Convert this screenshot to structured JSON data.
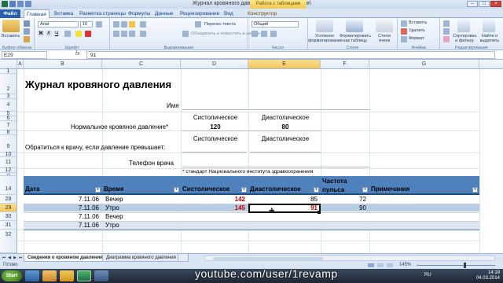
{
  "window": {
    "title": "Журнал кровяного давления1 - Microsoft Excel",
    "context_tab": "Работа с таблицами",
    "min_label": "–",
    "max_label": "□",
    "close_label": "×"
  },
  "ribbon_tabs": [
    {
      "label": "Файл"
    },
    {
      "label": "Главная"
    },
    {
      "label": "Вставка"
    },
    {
      "label": "Разметка страницы"
    },
    {
      "label": "Формулы"
    },
    {
      "label": "Данные"
    },
    {
      "label": "Рецензирование"
    },
    {
      "label": "Вид"
    },
    {
      "label": "Конструктор"
    }
  ],
  "ribbon": {
    "paste_label": "Вставить",
    "font_name": "Arial",
    "font_size": "10",
    "wrap_text": "Перенос текста",
    "merge_center": "Объединить и поместить в центре",
    "number_format": "Общий",
    "cond_format": "Условное форматирование",
    "format_table": "Форматировать как таблицу",
    "cell_styles": "Стили ячеек",
    "insert": "Вставить",
    "delete": "Удалить",
    "format": "Формат",
    "sort_filter": "Сортировка и фильтр",
    "find_select": "Найти и выделить",
    "groups": [
      "Буфер обмена",
      "Шрифт",
      "Выравнивание",
      "Число",
      "Стили",
      "Ячейки",
      "Редактирование"
    ]
  },
  "formula_bar": {
    "name_box": "E29",
    "fx": "fx",
    "value": "91"
  },
  "columns": [
    "A",
    "B",
    "C",
    "D",
    "E",
    "F",
    "G"
  ],
  "rows": [
    "1",
    "2",
    "3",
    "4",
    "5",
    "6",
    "7",
    "8",
    "9",
    "10",
    "11",
    "12",
    "13",
    "14",
    "28",
    "29",
    "30",
    "31",
    "32"
  ],
  "sheet": {
    "title": "Журнал кровяного давления",
    "name_label": "Имя",
    "systolic": "Систолическое",
    "diastolic": "Диастолическое",
    "normal_label": "Нормальное кровяное давление*",
    "normal_sys": "120",
    "normal_dia": "80",
    "doctor_label": "Обратиться к врачу, если давление превышает:",
    "phone_label": "Телефон врача",
    "footnote": "* стандарт Национального института здравоохранения"
  },
  "table": {
    "headers": [
      "Дата",
      "Время",
      "Систолическое",
      "Диастолическое",
      "Частота пульса",
      "Примечания"
    ],
    "filter_glyph": "▾",
    "rows": [
      {
        "date": "7.11.06",
        "time": "Вечер",
        "sys": "142",
        "dia": "85",
        "pulse": "72"
      },
      {
        "date": "7.11.06",
        "time": "Утро",
        "sys": "145",
        "dia": "91",
        "pulse": "90"
      },
      {
        "date": "7.11.06",
        "time": "Вечер",
        "sys": "",
        "dia": "",
        "pulse": ""
      },
      {
        "date": "7.11.06",
        "time": "Утро",
        "sys": "",
        "dia": "",
        "pulse": ""
      }
    ]
  },
  "sheet_tabs": [
    "Сведения о кровяном давлении",
    "Диаграмма кровяного давления"
  ],
  "status": {
    "ready": "Готово",
    "zoom": "145%"
  },
  "taskbar": {
    "start": "Start",
    "lang": "RU",
    "time": "14:18",
    "date": "04.03.2014"
  },
  "watermark": "youtube.com/user/1revamp",
  "colors": {
    "accent": "#2a5fb2",
    "header_blue": "#4f81bd",
    "band": "#dbe5f1",
    "alert_red": "#c00000",
    "selected_col": "#f4c659"
  }
}
